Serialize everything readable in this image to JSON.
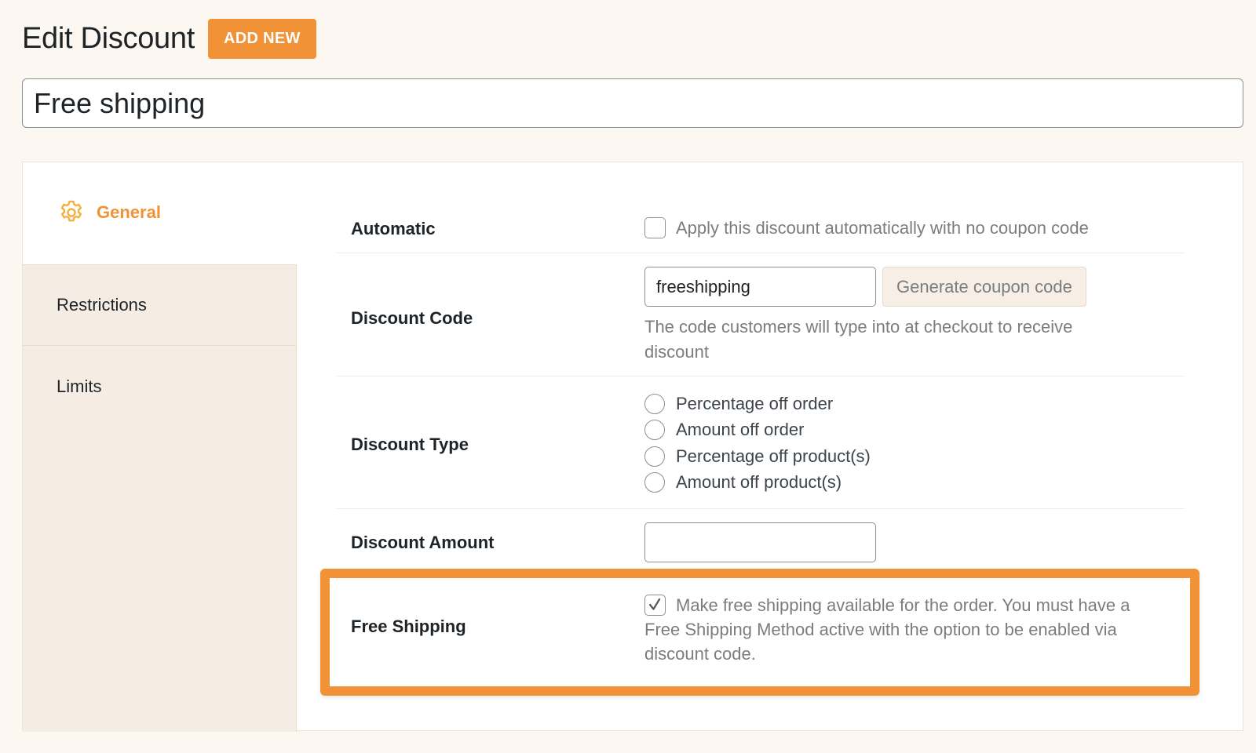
{
  "header": {
    "title": "Edit Discount",
    "add_new_label": "ADD NEW"
  },
  "discount_title": {
    "value": "Free shipping"
  },
  "sidebar": {
    "tabs": [
      {
        "label": "General",
        "icon": "gear-icon",
        "active": true
      },
      {
        "label": "Restrictions",
        "active": false
      },
      {
        "label": "Limits",
        "active": false
      }
    ]
  },
  "form": {
    "automatic": {
      "label": "Automatic",
      "checkbox_label": "Apply this discount automatically with no coupon code",
      "checked": false
    },
    "discount_code": {
      "label": "Discount Code",
      "value": "freeshipping",
      "generate_label": "Generate coupon code",
      "help_line1": "The code customers will type into at checkout to receive",
      "help_line2": "discount"
    },
    "discount_type": {
      "label": "Discount Type",
      "options": [
        {
          "label": "Percentage off order",
          "selected": false
        },
        {
          "label": "Amount off order",
          "selected": false
        },
        {
          "label": "Percentage off product(s)",
          "selected": false
        },
        {
          "label": "Amount off product(s)",
          "selected": false
        }
      ]
    },
    "discount_amount": {
      "label": "Discount Amount",
      "value": ""
    },
    "free_shipping": {
      "label": "Free Shipping",
      "checked": true,
      "line1": "Make free shipping available for the order. You must have a",
      "line2": "Free Shipping Method active with the option to be enabled via",
      "line3": "discount code."
    }
  },
  "colors": {
    "accent": "#f09235",
    "background": "#fcf7f1",
    "sidebar_bg": "#f5ede3"
  }
}
